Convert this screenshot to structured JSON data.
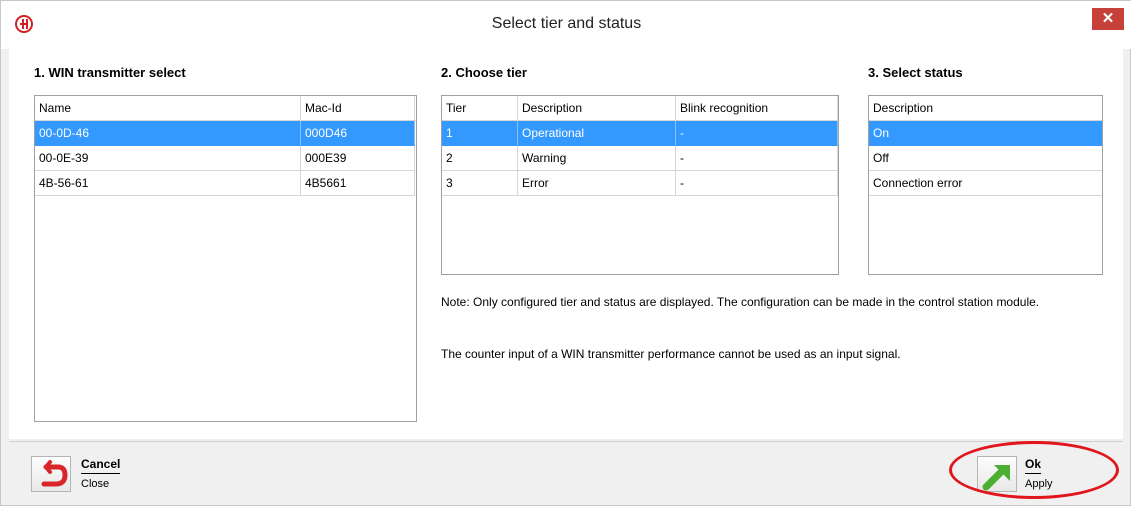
{
  "window": {
    "title": "Select tier and status",
    "close_label": "✕"
  },
  "transmitters": {
    "heading": "1. WIN transmitter select",
    "columns": [
      "Name",
      "Mac-Id"
    ],
    "rows": [
      {
        "name": "00-0D-46",
        "mac": "000D46",
        "selected": true
      },
      {
        "name": "00-0E-39",
        "mac": "000E39",
        "selected": false
      },
      {
        "name": "4B-56-61",
        "mac": "4B5661",
        "selected": false
      }
    ]
  },
  "tiers": {
    "heading": "2. Choose tier",
    "columns": [
      "Tier",
      "Description",
      "Blink recognition"
    ],
    "rows": [
      {
        "tier": "1",
        "description": "Operational",
        "blink": "-",
        "selected": true
      },
      {
        "tier": "2",
        "description": "Warning",
        "blink": "-",
        "selected": false
      },
      {
        "tier": "3",
        "description": "Error",
        "blink": "-",
        "selected": false
      }
    ]
  },
  "statuses": {
    "heading": "3. Select status",
    "columns": [
      "Description"
    ],
    "rows": [
      {
        "description": "On",
        "selected": true
      },
      {
        "description": "Off",
        "selected": false
      },
      {
        "description": "Connection error",
        "selected": false
      }
    ]
  },
  "notes": {
    "note1": "Note: Only configured tier and status are displayed. The configuration can be made in the control station module.",
    "note2": "The counter input of a WIN transmitter performance cannot be used as an input signal."
  },
  "footer": {
    "cancel_label": "Cancel",
    "cancel_sub": "Close",
    "ok_label": "Ok",
    "ok_sub": "Apply"
  },
  "colors": {
    "selection": "#3399ff",
    "close_button": "#c7403a",
    "highlight_ring": "#e2141c",
    "cancel_arrow": "#d9262a",
    "ok_arrow": "#4caf32"
  }
}
